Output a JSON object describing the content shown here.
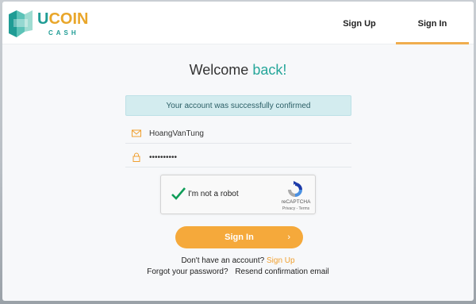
{
  "brand": {
    "word_u": "U",
    "word_rest": "COIN",
    "sub": "CASH"
  },
  "nav": {
    "signup_label": "Sign Up",
    "signin_label": "Sign In"
  },
  "welcome": {
    "prefix": "Welcome ",
    "accent": "back!"
  },
  "alert": {
    "message": "Your account was successfully confirmed"
  },
  "form": {
    "username_value": "HoangVanTung",
    "password_value": "••••••••••"
  },
  "captcha": {
    "label": "I'm not a robot",
    "brand": "reCAPTCHA",
    "links": "Privacy - Terms",
    "checked": true
  },
  "submit": {
    "label": "Sign In",
    "arrow": "›"
  },
  "footer": {
    "no_account_text": "Don't have an account?",
    "signup_link": "Sign Up",
    "forgot_link": "Forgot your password?",
    "resend_link": "Resend confirmation email"
  },
  "colors": {
    "brand_teal": "#1f9c95",
    "brand_gold": "#e9a62a",
    "button_orange": "#f5a93b",
    "alert_bg": "#d3ecef"
  },
  "icons": {
    "username": "envelope-icon",
    "password": "lock-icon",
    "captcha_check": "checkmark-icon",
    "captcha_logo": "recaptcha-logo-icon"
  }
}
